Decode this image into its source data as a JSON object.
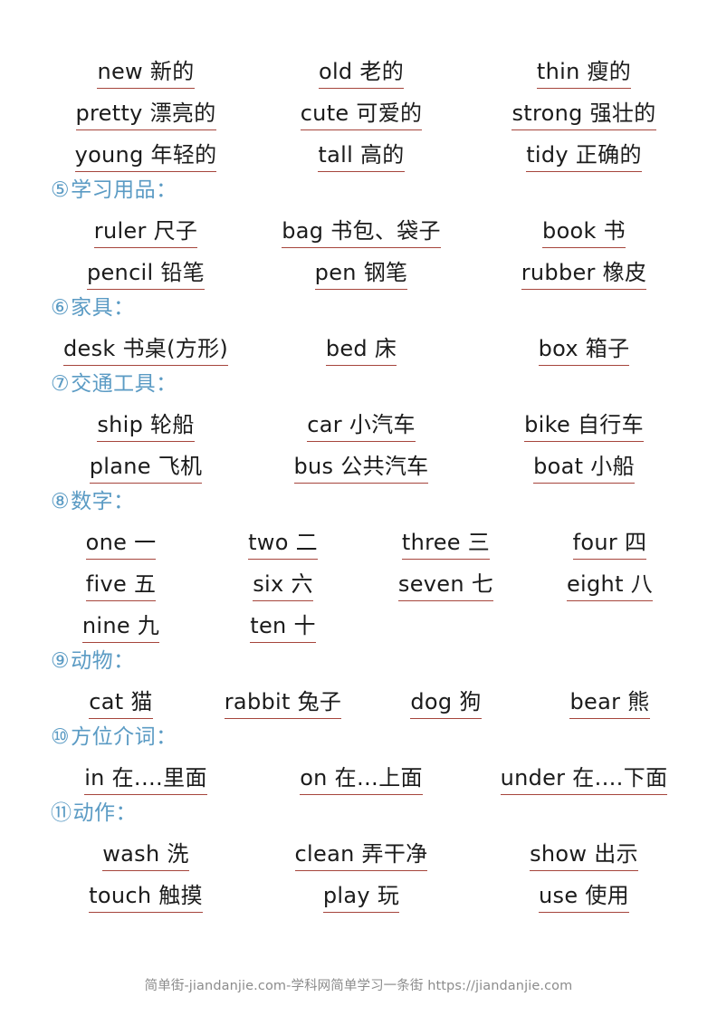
{
  "page": {
    "header_color": "#5b9bc4",
    "underline_color": "#a6453c",
    "text_color": "#1b1b1b"
  },
  "top_group": {
    "rows": [
      [
        "new 新的",
        "old 老的",
        "thin 瘦的"
      ],
      [
        "pretty 漂亮的",
        "cute 可爱的",
        "strong 强壮的"
      ],
      [
        "young 年轻的",
        "tall 高的",
        "tidy 正确的"
      ]
    ]
  },
  "sections": [
    {
      "number": "⑤",
      "label": "学习用品：",
      "columns": 3,
      "rows": [
        [
          "ruler 尺子",
          "bag 书包、袋子",
          "book 书"
        ],
        [
          "pencil 铅笔",
          "pen 钢笔",
          "rubber 橡皮"
        ]
      ]
    },
    {
      "number": "⑥",
      "label": "家具：",
      "columns": 3,
      "rows": [
        [
          "desk 书桌(方形)",
          "bed 床",
          "box 箱子"
        ]
      ]
    },
    {
      "number": "⑦",
      "label": "交通工具：",
      "columns": 3,
      "rows": [
        [
          "ship 轮船",
          "car 小汽车",
          "bike 自行车"
        ],
        [
          "plane 飞机",
          "bus 公共汽车",
          "boat 小船"
        ]
      ]
    },
    {
      "number": "⑧",
      "label": "数字：",
      "columns": 4,
      "rows": [
        [
          "one 一",
          "two 二",
          "three 三",
          "four 四"
        ],
        [
          "five 五",
          "six 六",
          "seven 七",
          "eight 八"
        ],
        [
          "nine 九",
          "ten 十",
          "",
          ""
        ]
      ]
    },
    {
      "number": "⑨",
      "label": "动物：",
      "columns": 4,
      "rows": [
        [
          "cat 猫",
          "rabbit 兔子",
          "dog 狗",
          "bear 熊"
        ]
      ]
    },
    {
      "number": "⑩",
      "label": "方位介词：",
      "columns": 3,
      "rows": [
        [
          "in 在.…里面",
          "on 在…上面",
          "under 在.…下面"
        ]
      ]
    },
    {
      "number": "⑪",
      "label": "动作：",
      "columns": 3,
      "rows": [
        [
          "wash 洗",
          "clean 弄干净",
          "show 出示"
        ],
        [
          "touch 触摸",
          "play 玩",
          "use 使用"
        ]
      ]
    }
  ],
  "footer": {
    "text": "简单街-jiandanjie.com-学科网简单学习一条街 https://jiandanjie.com"
  }
}
